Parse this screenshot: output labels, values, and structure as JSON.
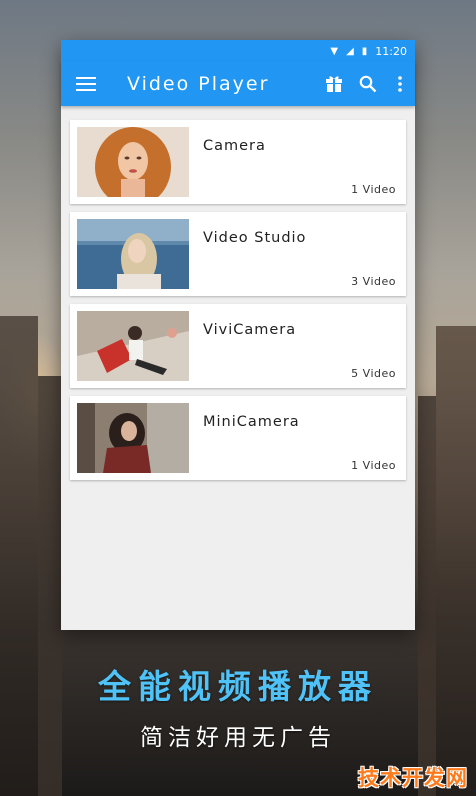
{
  "status_bar": {
    "time": "11:20"
  },
  "app_bar": {
    "title": "Video Player"
  },
  "folders": [
    {
      "name": "Camera",
      "count": "1 Video"
    },
    {
      "name": "Video Studio",
      "count": "3 Video"
    },
    {
      "name": "ViviCamera",
      "count": "5 Video"
    },
    {
      "name": "MiniCamera",
      "count": "1 Video"
    }
  ],
  "promo": {
    "headline": "全能视频播放器",
    "subline": "简洁好用无广告"
  },
  "watermark": "技术开发网",
  "colors": {
    "primary": "#2196f3",
    "headline": "#4fc3f7",
    "watermark": "#ff7a1a"
  }
}
